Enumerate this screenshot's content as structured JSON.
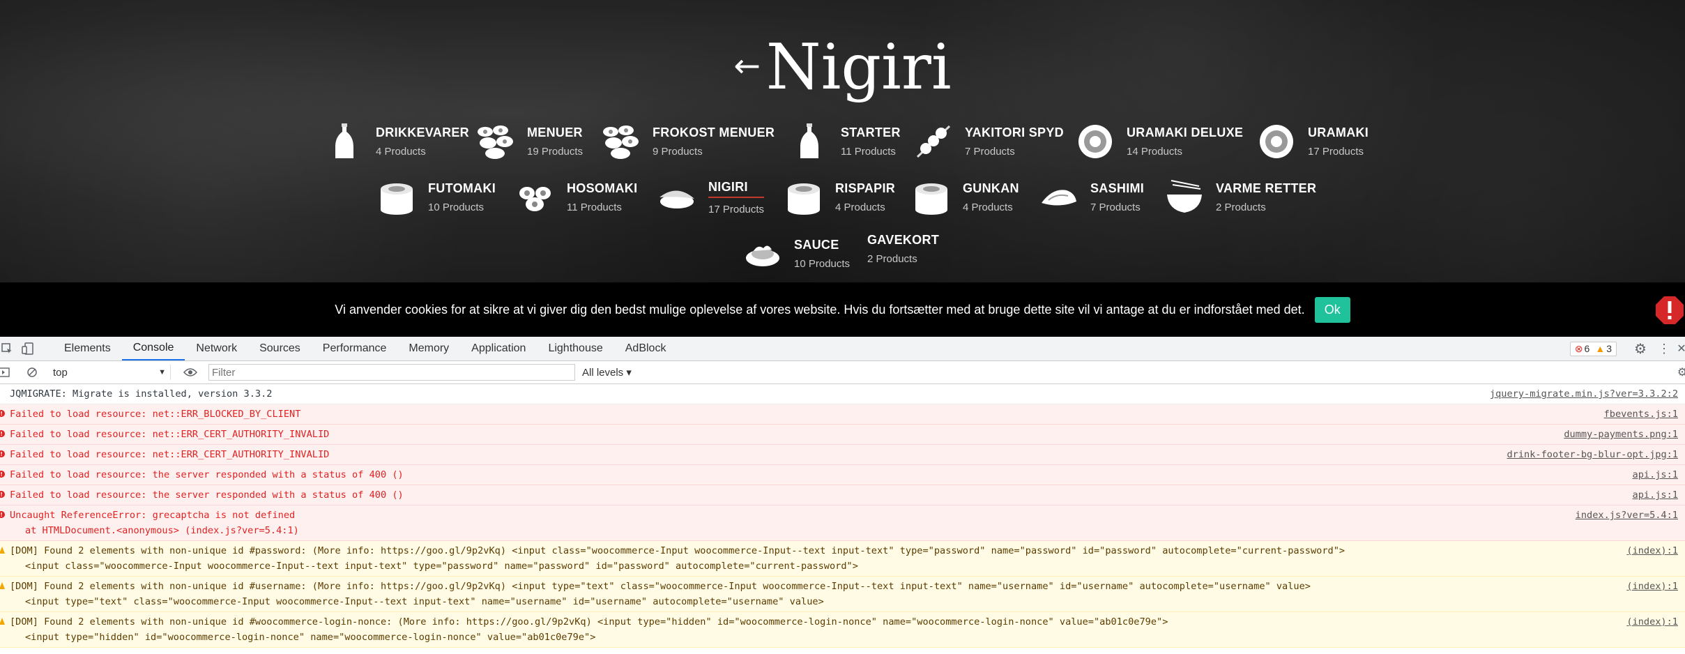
{
  "site": {
    "back_arrow": "←",
    "title": "Nigiri",
    "categories": [
      {
        "name": "DRIKKEVARER",
        "count": "4 Products",
        "icon": "bottle-icon"
      },
      {
        "name": "MENUER",
        "count": "19 Products",
        "icon": "sushi-platter-icon"
      },
      {
        "name": "FROKOST MENUER",
        "count": "9 Products",
        "icon": "sushi-platter-icon"
      },
      {
        "name": "STARTER",
        "count": "11 Products",
        "icon": "bottle-icon"
      },
      {
        "name": "YAKITORI SPYD",
        "count": "7 Products",
        "icon": "skewer-icon"
      },
      {
        "name": "URAMAKI DELUXE",
        "count": "14 Products",
        "icon": "roll-icon"
      },
      {
        "name": "URAMAKI",
        "count": "17 Products",
        "icon": "roll-icon"
      },
      {
        "name": "FUTOMAKI",
        "count": "10 Products",
        "icon": "maki-icon"
      },
      {
        "name": "HOSOMAKI",
        "count": "11 Products",
        "icon": "hosomaki-icon"
      },
      {
        "name": "NIGIRI",
        "count": "17 Products",
        "icon": "nigiri-icon",
        "active": true
      },
      {
        "name": "RISPAPIR",
        "count": "4 Products",
        "icon": "maki-icon"
      },
      {
        "name": "GUNKAN",
        "count": "4 Products",
        "icon": "maki-icon"
      },
      {
        "name": "SASHIMI",
        "count": "7 Products",
        "icon": "sashimi-icon"
      },
      {
        "name": "VARME RETTER",
        "count": "2 Products",
        "icon": "bowl-icon"
      },
      {
        "name": "SAUCE",
        "count": "10 Products",
        "icon": "sauce-icon"
      },
      {
        "name": "GAVEKORT",
        "count": "2 Products",
        "icon": ""
      }
    ]
  },
  "cookie": {
    "text": "Vi anvender cookies for at sikre at vi giver dig den bedst mulige oplevelse af vores website. Hvis du fortsætter med at bruge dette site vil vi antage at du er indforstået med det.",
    "ok_label": "Ok"
  },
  "devtools": {
    "tabs": [
      "Elements",
      "Console",
      "Network",
      "Sources",
      "Performance",
      "Memory",
      "Application",
      "Lighthouse",
      "AdBlock"
    ],
    "active_tab": "Console",
    "error_count": "6",
    "warning_count": "3",
    "context": "top",
    "filter_placeholder": "Filter",
    "levels": "All levels ▾",
    "messages": [
      {
        "type": "info",
        "text": "JQMIGRATE: Migrate is installed, version 3.3.2",
        "source": "jquery-migrate.min.js?ver=3.3.2:2"
      },
      {
        "type": "error",
        "text": "Failed to load resource: net::ERR_BLOCKED_BY_CLIENT",
        "source": "fbevents.js:1"
      },
      {
        "type": "error",
        "text": "Failed to load resource: net::ERR_CERT_AUTHORITY_INVALID",
        "source": "dummy-payments.png:1"
      },
      {
        "type": "error",
        "text": "Failed to load resource: net::ERR_CERT_AUTHORITY_INVALID",
        "source": "drink-footer-bg-blur-opt.jpg:1"
      },
      {
        "type": "error",
        "text": "Failed to load resource: the server responded with a status of 400 ()",
        "source": "api.js:1"
      },
      {
        "type": "error",
        "text": "Failed to load resource: the server responded with a status of 400 ()",
        "source": "api.js:1"
      },
      {
        "type": "error",
        "text": "Uncaught ReferenceError: grecaptcha is not defined",
        "line2": "    at HTMLDocument.<anonymous> (index.js?ver=5.4:1)",
        "source": "index.js?ver=5.4:1"
      },
      {
        "type": "warn",
        "text": "[DOM] Found 2 elements with non-unique id #password: (More info: https://goo.gl/9p2vKq)   <input class=\"woocommerce-Input woocommerce-Input--text input-text\" type=\"password\" name=\"password\" id=\"password\" autocomplete=\"current-password\">",
        "line2": "<input class=\"woocommerce-Input woocommerce-Input--text input-text\" type=\"password\" name=\"password\" id=\"password\" autocomplete=\"current-password\">",
        "source": "(index):1"
      },
      {
        "type": "warn",
        "text": "[DOM] Found 2 elements with non-unique id #username: (More info: https://goo.gl/9p2vKq)   <input type=\"text\" class=\"woocommerce-Input woocommerce-Input--text input-text\" name=\"username\" id=\"username\" autocomplete=\"username\" value>",
        "line2": "<input type=\"text\" class=\"woocommerce-Input woocommerce-Input--text input-text\" name=\"username\" id=\"username\" autocomplete=\"username\" value>",
        "source": "(index):1"
      },
      {
        "type": "warn",
        "text": "[DOM] Found 2 elements with non-unique id #woocommerce-login-nonce: (More info: https://goo.gl/9p2vKq)   <input type=\"hidden\" id=\"woocommerce-login-nonce\" name=\"woocommerce-login-nonce\" value=\"ab01c0e79e\">",
        "line2": "<input type=\"hidden\" id=\"woocommerce-login-nonce\" name=\"woocommerce-login-nonce\" value=\"ab01c0e79e\">",
        "source": "(index):1"
      }
    ]
  }
}
